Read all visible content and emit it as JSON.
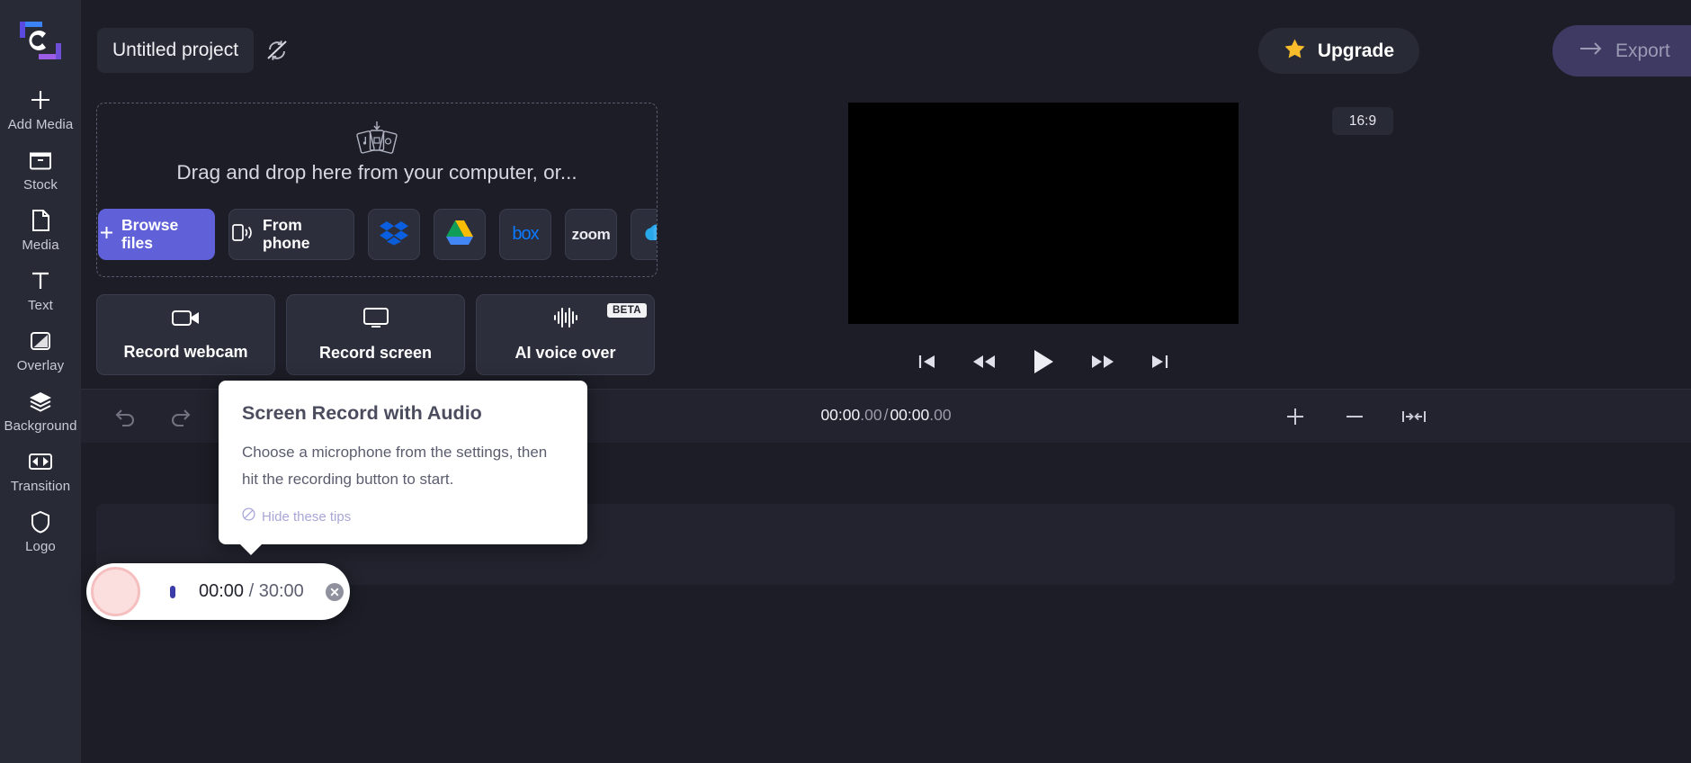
{
  "app": {
    "name": "Clipchamp",
    "logo_icon": "clipchamp-logo"
  },
  "sidebar": {
    "items": [
      {
        "label": "Add Media",
        "icon": "plus-icon"
      },
      {
        "label": "Stock",
        "icon": "stock-archive-icon"
      },
      {
        "label": "Media",
        "icon": "file-page-icon"
      },
      {
        "label": "Text",
        "icon": "text-t-icon"
      },
      {
        "label": "Overlay",
        "icon": "overlay-square-icon"
      },
      {
        "label": "Background",
        "icon": "layers-icon"
      },
      {
        "label": "Transition",
        "icon": "transition-icon"
      },
      {
        "label": "Logo",
        "icon": "shield-icon"
      }
    ]
  },
  "topbar": {
    "project_title": "Untitled project",
    "sync_icon": "sync-off-icon",
    "upgrade_label": "Upgrade",
    "upgrade_icon": "star-icon",
    "export_label": "Export",
    "export_icon": "arrow-right-icon",
    "upgrade_star_color": "#f9bd2c",
    "export_bg_color": "#3e3a63"
  },
  "import_panel": {
    "dropzone_icon": "media-cards-download-icon",
    "dropzone_text": "Drag and drop here from your computer, or...",
    "sources": [
      {
        "label": "Browse files",
        "icon": "plus-icon",
        "style": "primary",
        "brand_color": "#6060d8"
      },
      {
        "label": "From phone",
        "icon": "phone-wifi-icon",
        "style": "wide"
      },
      {
        "label": "",
        "icon": "dropbox-icon",
        "style": "icon-only",
        "brand_color": "#0a5fe0"
      },
      {
        "label": "",
        "icon": "google-drive-icon",
        "style": "icon-only"
      },
      {
        "label": "box",
        "icon": "box-icon",
        "style": "icon-only",
        "brand_color": "#0b7aff"
      },
      {
        "label": "zoom",
        "icon": "zoom-icon",
        "style": "icon-only",
        "brand_color": "#ffffff"
      },
      {
        "label": "",
        "icon": "onedrive-icon",
        "style": "icon-only",
        "brand_color": "#28a8ea"
      }
    ]
  },
  "record_cards": [
    {
      "label": "Record webcam",
      "icon": "video-camera-icon",
      "badge": ""
    },
    {
      "label": "Record screen",
      "icon": "monitor-icon",
      "badge": ""
    },
    {
      "label": "AI voice over",
      "icon": "waveform-icon",
      "badge": "BETA"
    }
  ],
  "preview": {
    "aspect_ratio": "16:9",
    "stage_color": "#000000",
    "controls": [
      {
        "name": "skip-to-start-button",
        "icon": "skip-start-icon"
      },
      {
        "name": "rewind-button",
        "icon": "rewind-icon"
      },
      {
        "name": "play-button",
        "icon": "play-icon"
      },
      {
        "name": "fast-forward-button",
        "icon": "fast-forward-icon"
      },
      {
        "name": "skip-to-end-button",
        "icon": "skip-end-icon"
      }
    ]
  },
  "timeline": {
    "undo_icon": "undo-arrow-icon",
    "redo_icon": "redo-arrow-icon",
    "current_time": "00:00",
    "current_frames": ".00",
    "separator": "/",
    "total_time": "00:00",
    "total_frames": ".00",
    "zoom_in_icon": "plus-icon",
    "zoom_out_icon": "minus-icon",
    "zoom_fit_icon": "fit-to-width-icon"
  },
  "tooltip": {
    "title": "Screen Record with Audio",
    "body": "Choose a microphone from the settings, then hit the recording button to start.",
    "hide_label": "Hide these tips",
    "hide_icon": "no-entry-icon",
    "bg_color": "#ffffff"
  },
  "recorder_pill": {
    "record_button_icon": "record-circle-icon",
    "elapsed": "00:00",
    "separator": "/",
    "duration": "30:00",
    "close_icon": "close-circle-icon",
    "accent_color": "#3b3ba8",
    "record_ring_color": "#f6bfbf"
  }
}
